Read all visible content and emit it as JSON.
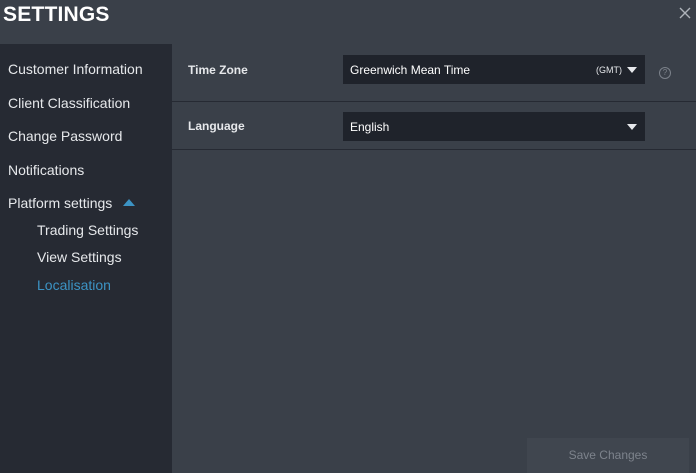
{
  "window": {
    "title": "SETTINGS"
  },
  "sidebar": {
    "items": [
      {
        "label": "Customer Information"
      },
      {
        "label": "Client Classification"
      },
      {
        "label": "Change Password"
      },
      {
        "label": "Notifications"
      },
      {
        "label": "Platform settings",
        "expanded": true
      }
    ],
    "subitems": [
      {
        "label": "Trading Settings"
      },
      {
        "label": "View Settings"
      },
      {
        "label": "Localisation",
        "active": true
      }
    ]
  },
  "settings": {
    "timezone": {
      "label": "Time Zone",
      "value": "Greenwich Mean Time",
      "abbr": "(GMT)",
      "help": "?"
    },
    "language": {
      "label": "Language",
      "value": "English"
    }
  },
  "actions": {
    "save_label": "Save Changes"
  },
  "colors": {
    "accent": "#3c93c4",
    "sidebar_bg": "#262a33",
    "content_bg": "#3a4049",
    "select_bg": "#1f232b"
  },
  "icons": {
    "close": "close-icon",
    "expand": "caret-up-icon",
    "dropdown": "chevron-down-icon",
    "help": "help-icon"
  }
}
